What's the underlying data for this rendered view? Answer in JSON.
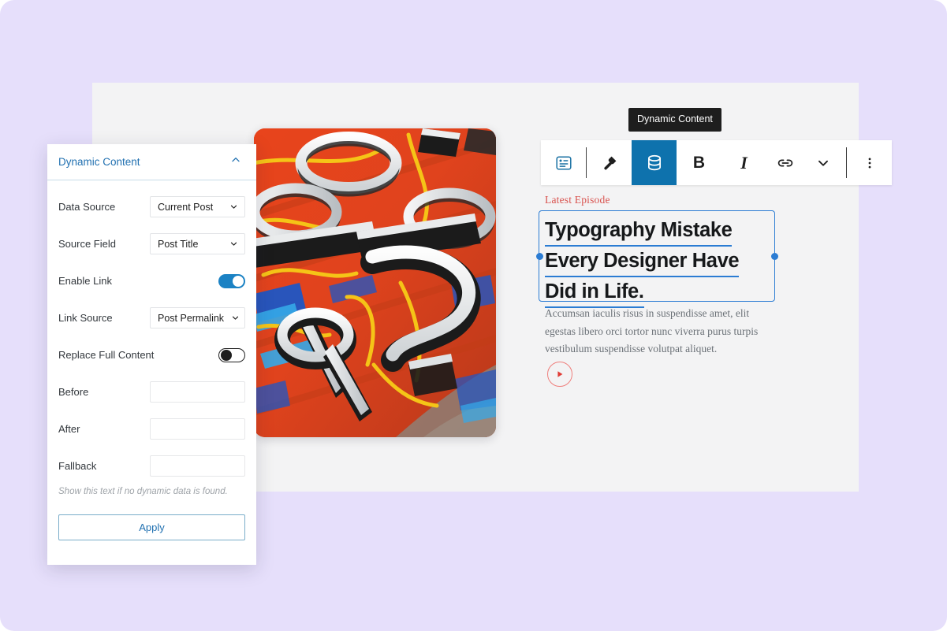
{
  "tooltip": {
    "text": "Dynamic Content"
  },
  "toolbar": {
    "items": [
      {
        "name": "block-type-icon",
        "label": "Block type"
      },
      {
        "name": "paintbrush-icon",
        "label": "Styles"
      },
      {
        "name": "database-icon",
        "label": "Dynamic Content",
        "active": true
      },
      {
        "name": "bold-icon",
        "label": "B"
      },
      {
        "name": "italic-icon",
        "label": "I"
      },
      {
        "name": "link-icon",
        "label": "Link"
      },
      {
        "name": "chevron-down-icon",
        "label": "More rich text controls"
      },
      {
        "name": "more-options-icon",
        "label": "Options"
      }
    ],
    "bold_label": "B",
    "italic_label": "I"
  },
  "post": {
    "eyebrow": "Latest Episode",
    "heading_lines": [
      "Typography Mistake",
      "Every Designer Have",
      "Did in Life. "
    ],
    "body": "Accumsan iaculis risus in suspendisse amet, elit egestas libero orci tortor nunc viverra purus turpis vestibulum suspendisse volutpat aliquet.",
    "play_label": "Play"
  },
  "panel": {
    "title": "Dynamic Content",
    "collapse_icon": "chevron-up-icon",
    "fields": [
      {
        "label": "Data Source",
        "type": "select",
        "value": "Current Post"
      },
      {
        "label": "Source Field",
        "type": "select",
        "value": "Post Title"
      },
      {
        "label": "Enable Link",
        "type": "toggle",
        "value": "on"
      },
      {
        "label": "Link Source",
        "type": "select",
        "value": "Post Permalink"
      },
      {
        "label": "Replace Full Content",
        "type": "toggle",
        "value": "off"
      },
      {
        "label": "Before",
        "type": "text",
        "value": "",
        "placeholder": ""
      },
      {
        "label": "After",
        "type": "text",
        "value": "",
        "placeholder": ""
      },
      {
        "label": "Fallback",
        "type": "text",
        "value": "",
        "placeholder": ""
      }
    ],
    "hint": "Show this text if no dynamic data is found.",
    "apply_label": "Apply"
  },
  "colors": {
    "backdrop": "#e6dffb",
    "canvas": "#f3f3f4",
    "accent_blue": "#2271b1",
    "toolbar_active": "#0e72ad",
    "selection_blue": "#2b7cd3",
    "eyebrow_red": "#d9534f",
    "play_red": "#ef7f7c",
    "toggle_on": "#1b82c4"
  }
}
